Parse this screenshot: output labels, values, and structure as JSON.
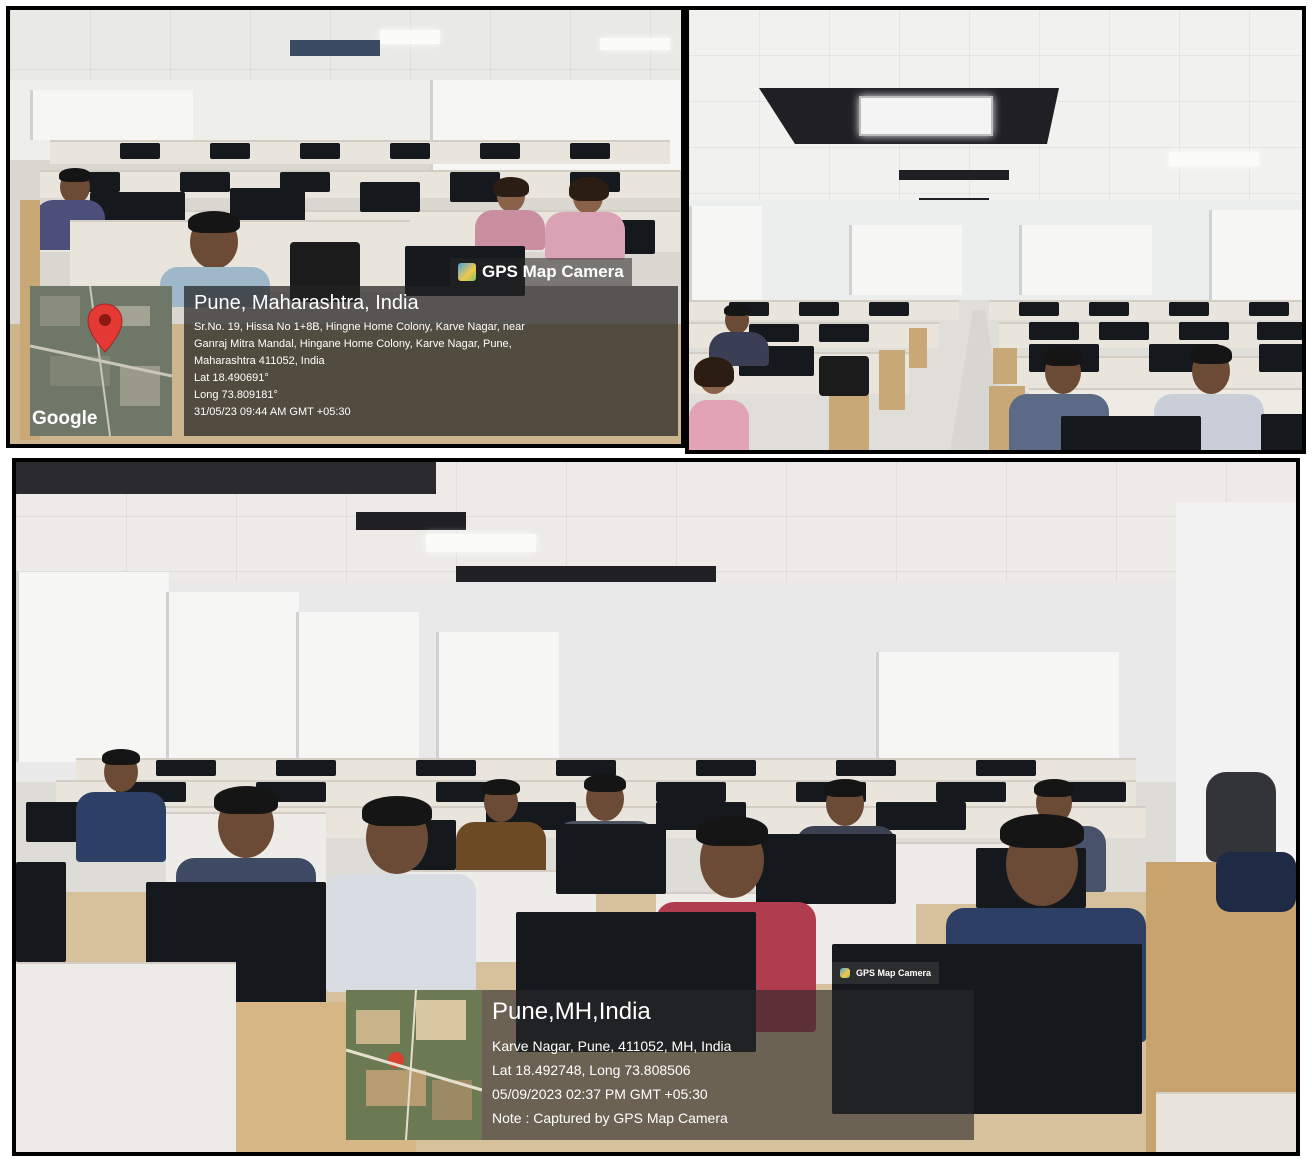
{
  "photo_top_left": {
    "badge": "GPS Map Camera",
    "location_title": "Pune, Maharashtra, India",
    "address_lines": [
      "Sr.No. 19, Hissa No 1+8B, Hingne Home Colony, Karve Nagar, near",
      "Ganraj Mitra Mandal, Hingane Home Colony, Karve Nagar, Pune,",
      "Maharashtra 411052, India"
    ],
    "lat": "Lat 18.490691°",
    "long": "Long 73.809181°",
    "timestamp": "31/05/23 09:44 AM GMT +05:30",
    "map_brand": "Google"
  },
  "photo_bottom": {
    "badge": "GPS Map Camera",
    "location_title": "Pune,MH,India",
    "lines": [
      "Karve Nagar, Pune, 411052, MH, India",
      "Lat 18.492748, Long 73.808506",
      "05/09/2023 02:37 PM GMT +05:30",
      "Note : Captured by GPS Map Camera"
    ]
  },
  "colors": {
    "map_pin": "#e53935",
    "overlay_bg": "#232323"
  }
}
